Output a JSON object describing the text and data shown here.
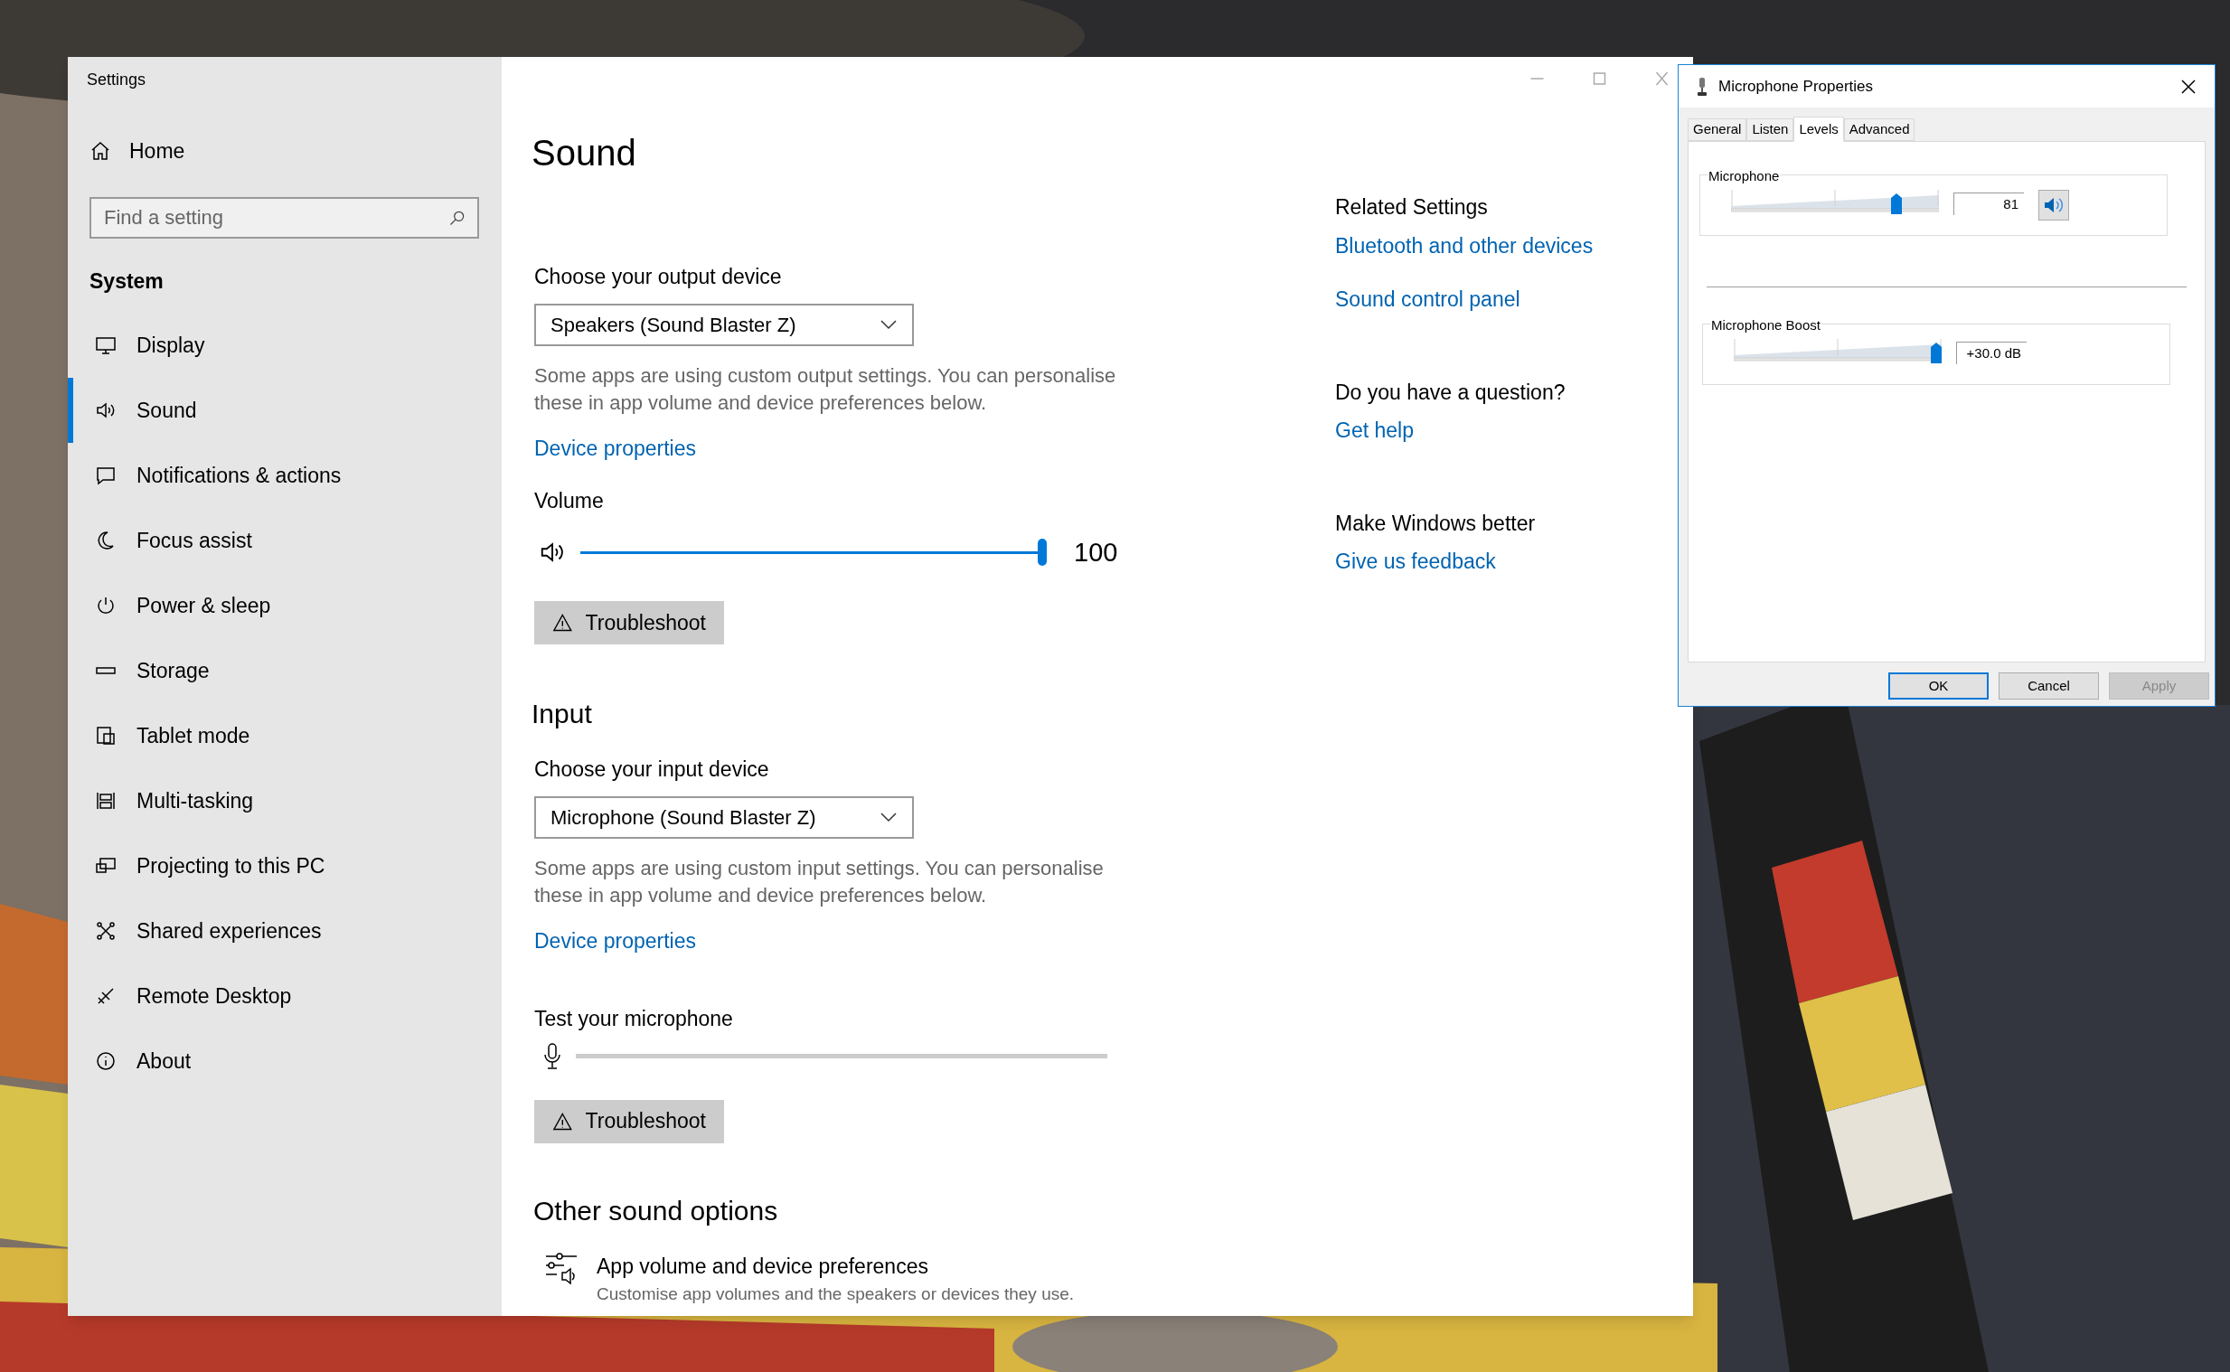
{
  "settings_window": {
    "title": "Settings"
  },
  "sidebar": {
    "home": "Home",
    "search": {
      "placeholder": "Find a setting"
    },
    "section": "System",
    "items": [
      {
        "label": "Display",
        "kind": "display",
        "selected": false
      },
      {
        "label": "Sound",
        "kind": "sound",
        "selected": true
      },
      {
        "label": "Notifications & actions",
        "kind": "notifications",
        "selected": false
      },
      {
        "label": "Focus assist",
        "kind": "focus",
        "selected": false
      },
      {
        "label": "Power & sleep",
        "kind": "power",
        "selected": false
      },
      {
        "label": "Storage",
        "kind": "storage",
        "selected": false
      },
      {
        "label": "Tablet mode",
        "kind": "tablet",
        "selected": false
      },
      {
        "label": "Multi-tasking",
        "kind": "multitasking",
        "selected": false
      },
      {
        "label": "Projecting to this PC",
        "kind": "projecting",
        "selected": false
      },
      {
        "label": "Shared experiences",
        "kind": "shared",
        "selected": false
      },
      {
        "label": "Remote Desktop",
        "kind": "remote",
        "selected": false
      },
      {
        "label": "About",
        "kind": "about",
        "selected": false
      }
    ]
  },
  "main": {
    "title": "Sound",
    "output": {
      "label": "Choose your output device",
      "device": "Speakers (Sound Blaster Z)",
      "note": "Some apps are using custom output settings. You can personalise these in app volume and device preferences below.",
      "link": "Device properties",
      "volume_label": "Volume",
      "volume": {
        "level": 1,
        "reading": "100"
      },
      "troubleshoot": "Troubleshoot"
    },
    "input": {
      "heading": "Input",
      "label": "Choose your input device",
      "device": "Microphone (Sound Blaster Z)",
      "note": "Some apps are using custom input settings. You can personalise these in app volume and device preferences below.",
      "link": "Device properties",
      "test_label": "Test your microphone",
      "meter": {
        "level": 0
      },
      "troubleshoot": "Troubleshoot"
    },
    "other": {
      "heading": "Other sound options",
      "item": {
        "title": "App volume and device preferences",
        "description": "Customise app volumes and the speakers or devices they use."
      }
    }
  },
  "related": [
    {
      "heading": "Related Settings",
      "links": [
        "Bluetooth and other devices",
        "Sound control panel"
      ]
    },
    {
      "heading": "Do you have a question?",
      "links": [
        "Get help"
      ]
    },
    {
      "heading": "Make Windows better",
      "links": [
        "Give us feedback"
      ]
    }
  ],
  "dialog": {
    "title": "Microphone Properties",
    "tabs": [
      {
        "label": "General",
        "selected": false
      },
      {
        "label": "Listen",
        "selected": false
      },
      {
        "label": "Levels",
        "selected": true
      },
      {
        "label": "Advanced",
        "selected": false
      }
    ],
    "groups": [
      {
        "label": "Microphone",
        "level": 0.81,
        "value": "81",
        "kind": "with_mute"
      },
      {
        "label": "Microphone Boost",
        "level": 1,
        "value": "+30.0 dB",
        "kind": "plain"
      }
    ],
    "buttons": [
      {
        "label": "OK",
        "default": true,
        "disabled": false
      },
      {
        "label": "Cancel",
        "default": false,
        "disabled": false
      },
      {
        "label": "Apply",
        "default": false,
        "disabled": true
      }
    ]
  }
}
